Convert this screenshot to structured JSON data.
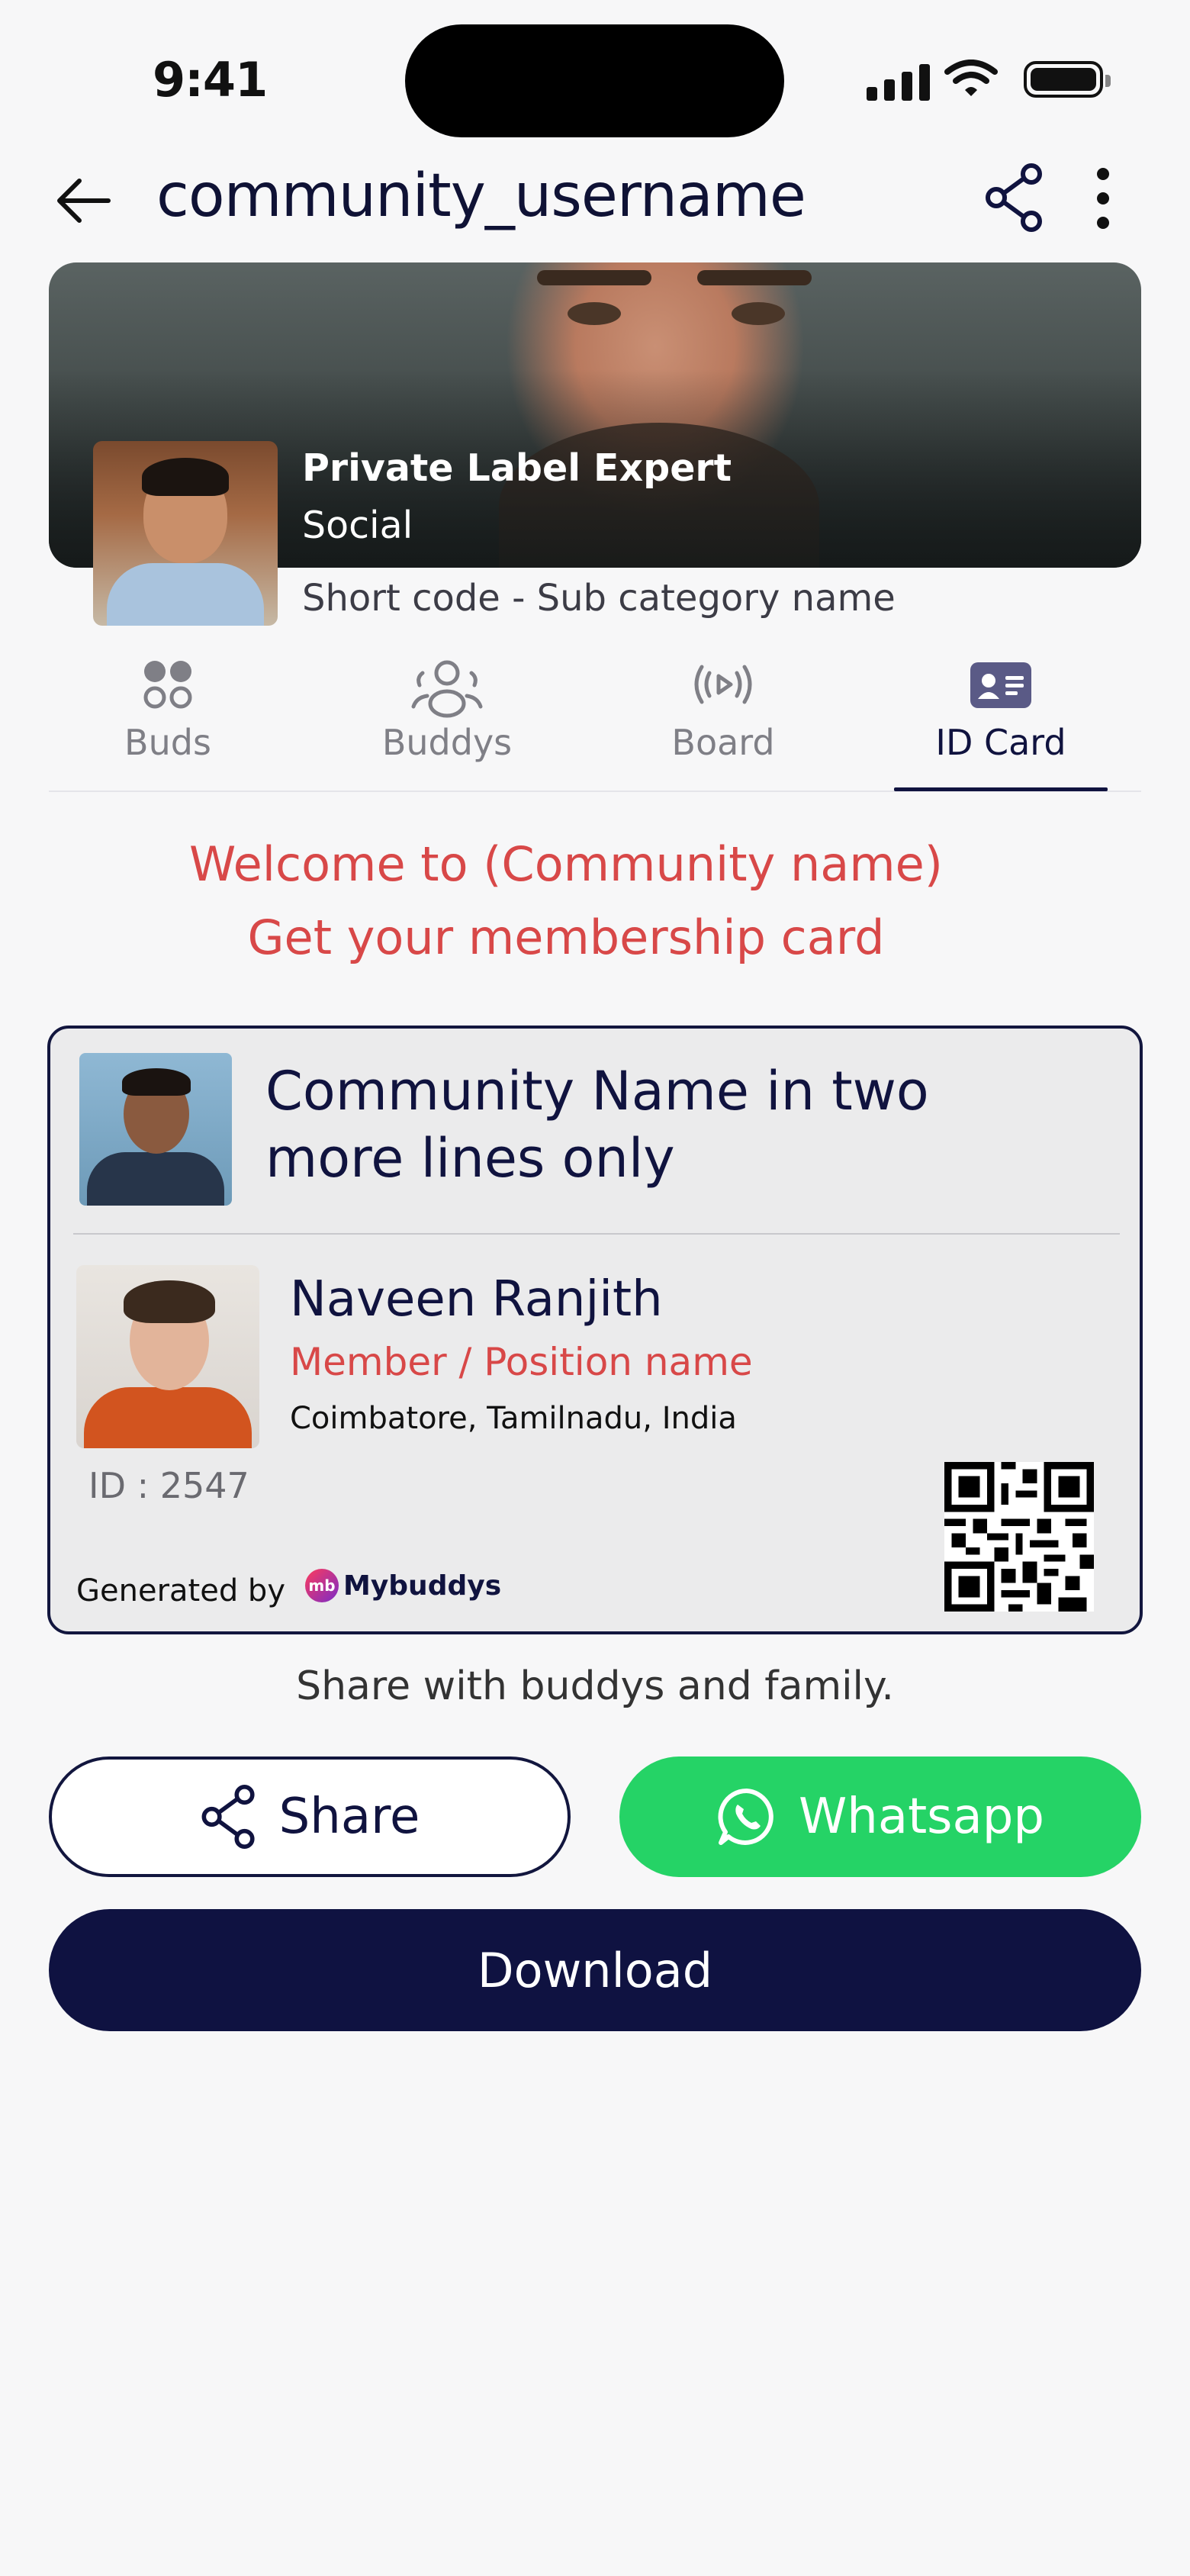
{
  "status_bar": {
    "time": "9:41"
  },
  "header": {
    "title": "community_username"
  },
  "profile": {
    "label": "Private Label Expert",
    "category": "Social",
    "short_code": "Short code - Sub category name"
  },
  "tabs": [
    {
      "label": "Buds",
      "icon": "buds-icon",
      "active": false
    },
    {
      "label": "Buddys",
      "icon": "buddys-icon",
      "active": false
    },
    {
      "label": "Board",
      "icon": "board-icon",
      "active": false
    },
    {
      "label": "ID Card",
      "icon": "id-card-icon",
      "active": true
    }
  ],
  "welcome": {
    "line1": "Welcome to (Community name)",
    "line2": "Get your membership card"
  },
  "id_card": {
    "community_name": "Community Name in two more lines only",
    "member_name": "Naveen Ranjith",
    "position": "Member / Position name",
    "location": "Coimbatore, Tamilnadu, India",
    "id": "ID : 2547",
    "generated_by": "Generated by",
    "brand": "Mybuddys",
    "brand_badge": "mb"
  },
  "share_note": "Share with buddys and family.",
  "buttons": {
    "share": "Share",
    "whatsapp": "Whatsapp",
    "download": "Download"
  },
  "colors": {
    "navy": "#10133f",
    "accent_red": "#d84848",
    "whatsapp_green": "#25d366"
  }
}
